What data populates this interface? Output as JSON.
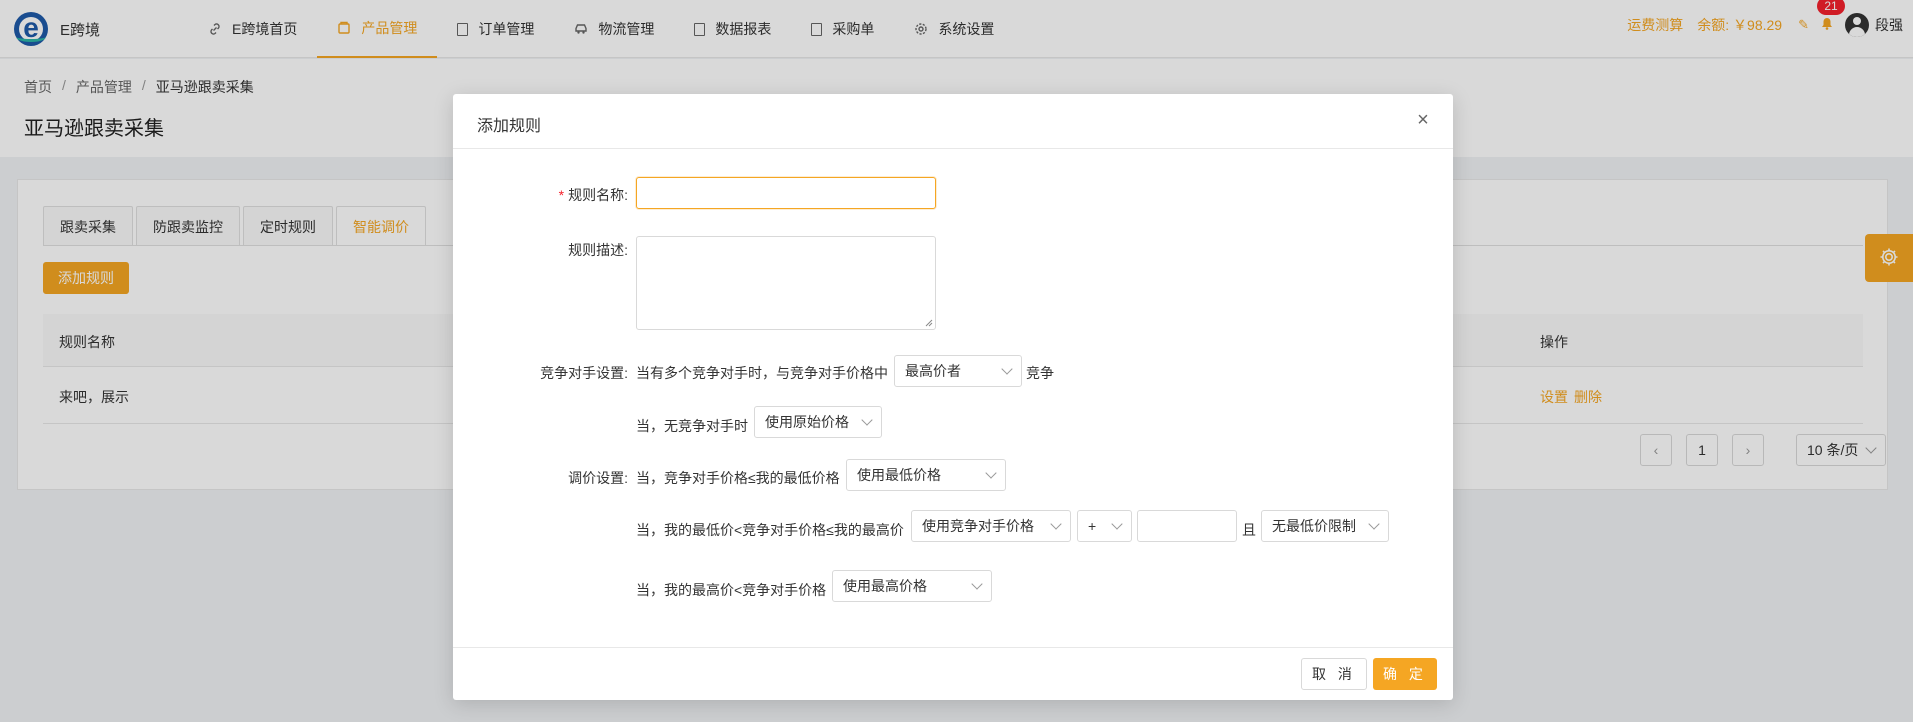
{
  "app": {
    "name": "E跨境"
  },
  "nav": [
    {
      "label": "E跨境首页",
      "icon": "link-icon"
    },
    {
      "label": "产品管理",
      "icon": "box-icon",
      "active": true
    },
    {
      "label": "订单管理",
      "icon": "doc-icon"
    },
    {
      "label": "物流管理",
      "icon": "car-icon"
    },
    {
      "label": "数据报表",
      "icon": "doc-icon"
    },
    {
      "label": "采购单",
      "icon": "doc-icon"
    },
    {
      "label": "系统设置",
      "icon": "gear-icon"
    }
  ],
  "topright": {
    "shipping_calc": "运费测算",
    "balance": "余额: ￥98.29",
    "notifications": "21",
    "username": "段强"
  },
  "breadcrumb": [
    "首页",
    "产品管理",
    "亚马逊跟卖采集"
  ],
  "page_title": "亚马逊跟卖采集",
  "tabs": [
    {
      "label": "跟卖采集"
    },
    {
      "label": "防跟卖监控"
    },
    {
      "label": "定时规则"
    },
    {
      "label": "智能调价",
      "active": true
    }
  ],
  "add_rule_button": "添加规则",
  "table": {
    "columns": [
      "规则名称",
      "操作"
    ],
    "rows": [
      {
        "name": "来吧，展示",
        "ops": [
          "设置",
          "删除"
        ]
      }
    ]
  },
  "pagination": {
    "current": "1",
    "page_size": "10 条/页"
  },
  "modal": {
    "title": "添加规则",
    "fields": {
      "rule_name_label": "规则名称:",
      "rule_name_value": "",
      "rule_desc_label": "规则描述:",
      "rule_desc_value": "",
      "competitor_label": "竞争对手设置:",
      "competitor_text1": "当有多个竞争对手时，与竞争对手价格中",
      "competitor_select": "最高价者",
      "competitor_text2": "竞争",
      "no_competitor_text": "当，无竞争对手时",
      "no_competitor_select": "使用原始价格",
      "price_label": "调价设置:",
      "price_row1_text": "当，竞争对手价格≤我的最低价格",
      "price_row1_select": "使用最低价格",
      "price_row2_text": "当，我的最低价<竞争对手价格≤我的最高价",
      "price_row2_select": "使用竞争对手价格",
      "price_row2_op": "+",
      "price_row2_amount": "",
      "price_row2_and": "且",
      "price_row2_limit": "无最低价限制",
      "price_row3_text": "当，我的最高价<竞争对手价格",
      "price_row3_select": "使用最高价格"
    },
    "cancel": "取 消",
    "ok": "确 定"
  },
  "colors": {
    "accent": "#f5a623",
    "badge": "#f5222d",
    "brand": "#1e5aa8"
  }
}
